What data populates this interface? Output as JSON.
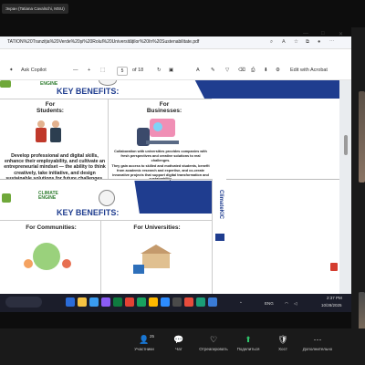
{
  "zoom_top": {
    "label": "Экран (Tatiana Cavalschi, MSU)"
  },
  "window": {
    "url": "TATION%20Tranziția%20Verde%20și%20Rolul%20Universităților%20în%20Sustenabilitate.pdf",
    "controls": [
      "—",
      "□",
      "✕"
    ]
  },
  "toolbar": {
    "ask_copilot": "Ask Copilot",
    "minus": "—",
    "plus": "+",
    "page_current": "5",
    "page_total": "of 18",
    "edit_with_acrobat": "Edit with Acrobat"
  },
  "slide_top": {
    "title": "KEY BENEFITS:",
    "engine_label": "ENGINE",
    "students_heading": "For\nStudents:",
    "businesses_heading": "For\nBusinesses:",
    "students_text": "Develop professional and digital skills, enhance their employability, and cultivate an entrepreneurial mindset — the ability to think creatively, take initiative, and design sustainable solutions for future challenges.",
    "businesses_text_1": "Collaboration with universities provides companies with fresh perspectives and creative solutions to real challenges.",
    "businesses_text_2": "They gain access to skilled and motivated students, benefit from academic research and expertise, and co-create innovative projects that support digital transformation and sustainability."
  },
  "slide_bottom": {
    "logo_text": "CLIMATE\nENGINE",
    "title": "KEY BENEFITS:",
    "communities_heading": "For Communities:",
    "universities_heading": "For Universities:",
    "side_band_text": "ClimateKIC"
  },
  "taskbar": {
    "language": "ENG",
    "time": "2:37 PM",
    "date": "10/28/2025",
    "app_colors": [
      "#2b6cd8",
      "#f6c343",
      "#3a9cf0",
      "#8b5cf6",
      "#0f7b3f",
      "#e34234",
      "#19a15f",
      "#ffb900",
      "#2d8cff",
      "#4a4a4a",
      "#e74c3c",
      "#1b9e77",
      "#3a7bd5"
    ]
  },
  "zoom_bottom": {
    "items": [
      {
        "icon": "user-icon",
        "glyph": "👤",
        "badge": "25",
        "label": "Участники"
      },
      {
        "icon": "chat-icon",
        "glyph": "💬",
        "label": "Чат"
      },
      {
        "icon": "react-icon",
        "glyph": "♡",
        "label": "Отреагировать"
      },
      {
        "icon": "share-icon",
        "glyph": "⬆",
        "label": "Поделиться"
      },
      {
        "icon": "host-tools-icon",
        "glyph": "🛡",
        "label": "Хост"
      },
      {
        "icon": "more-icon",
        "glyph": "⋯",
        "label": "Дополнительно"
      }
    ]
  }
}
